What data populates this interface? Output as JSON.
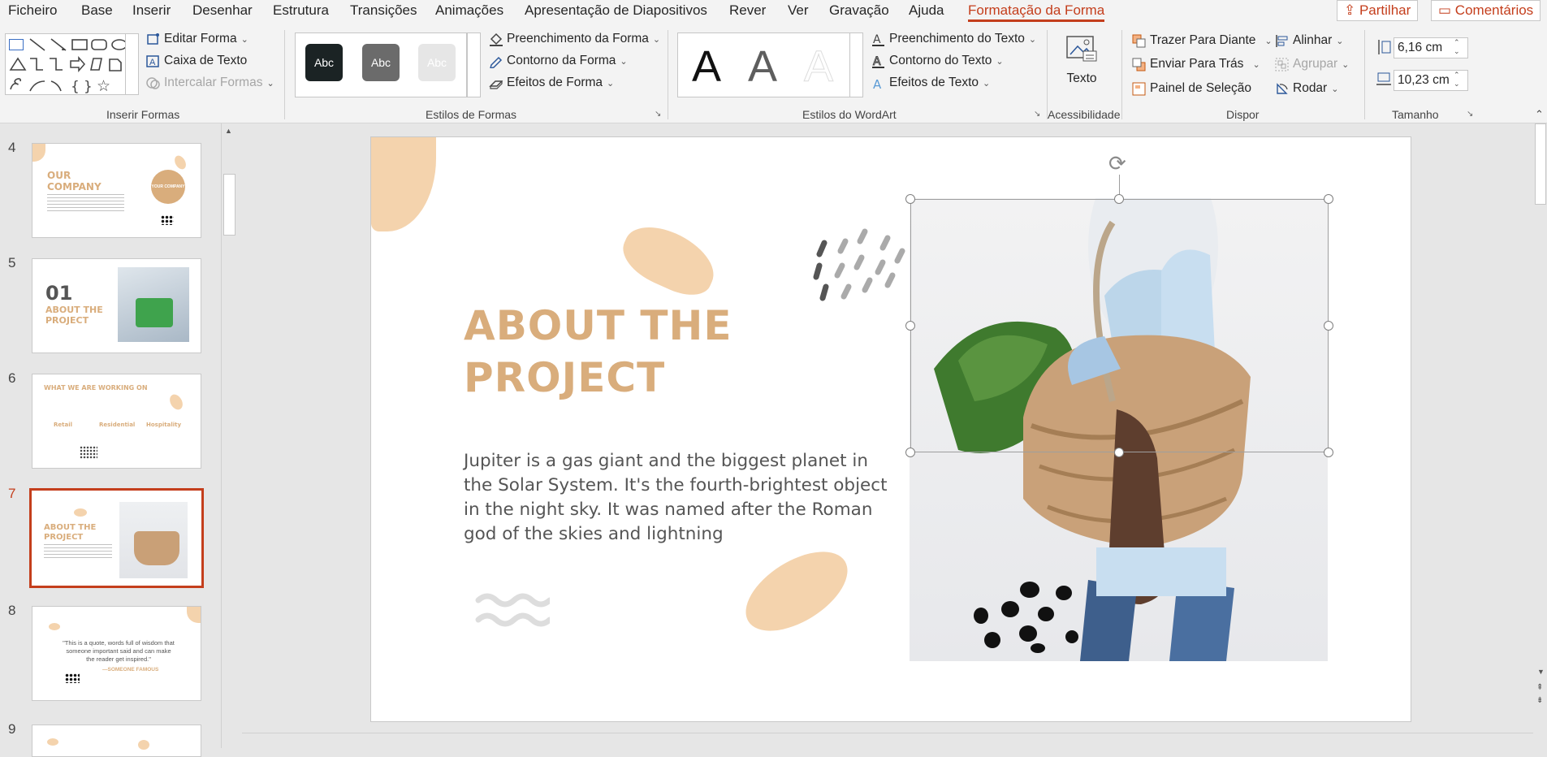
{
  "menu": [
    "Ficheiro",
    "Base",
    "Inserir",
    "Desenhar",
    "Estrutura",
    "Transições",
    "Animações",
    "Apresentação de Diapositivos",
    "Rever",
    "Ver",
    "Gravação",
    "Ajuda",
    "Formatação da Forma"
  ],
  "top_buttons": {
    "share": "Partilhar",
    "comments": "Comentários"
  },
  "ribbon": {
    "insert_shapes": {
      "edit_shape": "Editar Forma",
      "text_box": "Caixa de Texto",
      "merge_shapes": "Intercalar Formas",
      "label": "Inserir Formas"
    },
    "shape_styles": {
      "swatch_text": "Abc",
      "fill": "Preenchimento da Forma",
      "outline": "Contorno da Forma",
      "effects": "Efeitos de Forma",
      "label": "Estilos de Formas"
    },
    "wordart": {
      "glyph": "A",
      "text_fill": "Preenchimento do Texto",
      "text_outline": "Contorno do Texto",
      "text_effects": "Efeitos de Texto",
      "label": "Estilos do WordArt"
    },
    "accessibility": {
      "alt_text": "Texto",
      "label": "Acessibilidade"
    },
    "arrange": {
      "bring_forward": "Trazer Para Diante",
      "send_backward": "Enviar Para Trás",
      "selection_pane": "Painel de Seleção",
      "align": "Alinhar",
      "group": "Agrupar",
      "rotate": "Rodar",
      "label": "Dispor"
    },
    "size": {
      "height": "6,16 cm",
      "width": "10,23 cm",
      "label": "Tamanho"
    }
  },
  "slides": [
    {
      "num": "4",
      "title1": "OUR",
      "title2": "COMPANY",
      "badge": "YOUR COMPANY"
    },
    {
      "num": "5",
      "big": "01",
      "title1": "ABOUT THE",
      "title2": "PROJECT"
    },
    {
      "num": "6",
      "title1": "WHAT WE ARE WORKING ON",
      "c1": "Retail",
      "c2": "Residential",
      "c3": "Hospitality"
    },
    {
      "num": "7",
      "title1": "ABOUT THE",
      "title2": "PROJECT"
    },
    {
      "num": "8",
      "quote": "\"This is a quote, words full of wisdom that someone important said and can make the reader get inspired.\"",
      "author": "—SOMEONE FAMOUS"
    },
    {
      "num": "9"
    }
  ],
  "slide": {
    "title_line1": "ABOUT THE",
    "title_line2": "PROJECT",
    "body": "Jupiter is a gas giant and the biggest planet in the Solar System. It's the fourth-brightest object in the night sky. It was named after the Roman god of the skies and lightning"
  },
  "colors": {
    "accent": "#c43e1c",
    "title": "#d9ad7c",
    "blob": "#f4d3ad"
  }
}
